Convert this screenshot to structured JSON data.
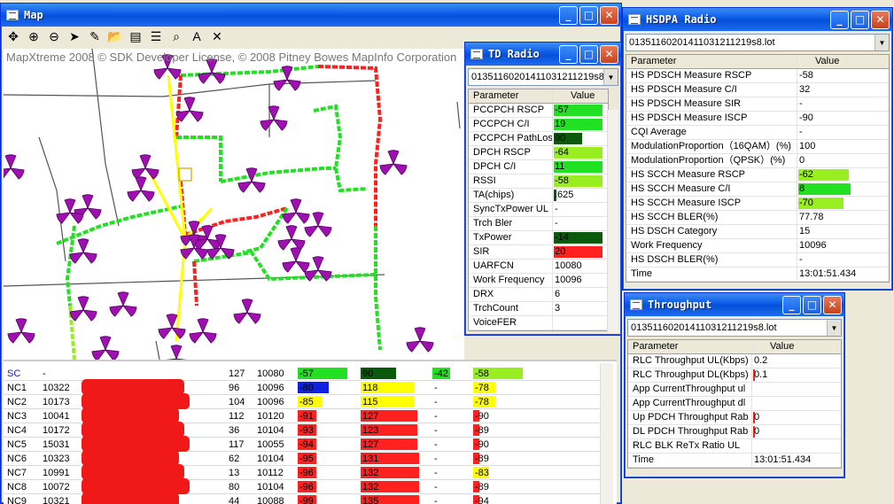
{
  "colors": {
    "green": "#22e022",
    "lightgreen": "#99ee22",
    "darkgreen": "#0b5a0b",
    "yellow": "#ffff00",
    "red": "#ff2020",
    "blue": "#1020e0"
  },
  "map": {
    "title": "Map",
    "copyright": "MapXtreme 2008 © SDK Developer License, © 2008 Pitney Bowes MapInfo Corporation",
    "tools": [
      "pan-icon",
      "zoom-in-icon",
      "zoom-out-icon",
      "pointer-icon",
      "ruler-icon",
      "open-folder-icon",
      "layers-icon",
      "legend-icon",
      "find-icon",
      "text-icon",
      "clear-icon"
    ],
    "tool_glyphs": [
      "✥",
      "⊕",
      "⊖",
      "➤",
      "✎",
      "📂",
      "▤",
      "☰",
      "⌕",
      "A",
      "✕"
    ]
  },
  "td_radio": {
    "title": "TD Radio",
    "file": "01351160201411031211219s8.lot",
    "col_param": "Parameter",
    "col_value": "Value",
    "rows": [
      {
        "p": "PCCPCH RSCP",
        "v": "-57",
        "bar": 0.95,
        "c": "green"
      },
      {
        "p": "PCCPCH C/I",
        "v": "19",
        "bar": 0.95,
        "c": "green"
      },
      {
        "p": "PCCPCH PathLoss",
        "v": "90",
        "bar": 0.55,
        "c": "darkgreen"
      },
      {
        "p": "DPCH RSCP",
        "v": "-64",
        "bar": 0.95,
        "c": "lightgreen"
      },
      {
        "p": "DPCH C/I",
        "v": "11",
        "bar": 0.95,
        "c": "green"
      },
      {
        "p": "RSSI",
        "v": "-58",
        "bar": 0.95,
        "c": "lightgreen"
      },
      {
        "p": "TA(chips)",
        "v": ".625",
        "bar": 0.06,
        "c": "darkgreen"
      },
      {
        "p": "SyncTxPower UL",
        "v": "-",
        "bar": 0,
        "c": ""
      },
      {
        "p": "Trch Bler",
        "v": "-",
        "bar": 0,
        "c": ""
      },
      {
        "p": "TxPower",
        "v": "-14",
        "bar": 0.95,
        "c": "darkgreen"
      },
      {
        "p": "SIR",
        "v": "20",
        "bar": 0.95,
        "c": "red"
      },
      {
        "p": "UARFCN",
        "v": "10080",
        "bar": 0,
        "c": ""
      },
      {
        "p": "Work Frequency",
        "v": "10096",
        "bar": 0,
        "c": ""
      },
      {
        "p": "DRX",
        "v": "6",
        "bar": 0,
        "c": ""
      },
      {
        "p": "TrchCount",
        "v": "3",
        "bar": 0,
        "c": ""
      },
      {
        "p": "VoiceFER",
        "v": "",
        "bar": 0,
        "c": ""
      }
    ]
  },
  "hsdpa": {
    "title": "HSDPA Radio",
    "file": "01351160201411031211219s8.lot",
    "col_param": "Parameter",
    "col_value": "Value",
    "rows": [
      {
        "p": "HS PDSCH Measure RSCP",
        "v": "-58",
        "bar": 0,
        "c": ""
      },
      {
        "p": "HS PDSCH Measure C/I",
        "v": "32",
        "bar": 0,
        "c": ""
      },
      {
        "p": "HS PDSCH Measure SIR",
        "v": "-",
        "bar": 0,
        "c": ""
      },
      {
        "p": "HS PDSCH Measure ISCP",
        "v": "-90",
        "bar": 0,
        "c": ""
      },
      {
        "p": "CQI Average",
        "v": "-",
        "bar": 0,
        "c": ""
      },
      {
        "p": "ModulationProportion（16QAM）(%)",
        "v": "100",
        "bar": 0,
        "c": ""
      },
      {
        "p": "ModulationProportion（QPSK）(%)",
        "v": "0",
        "bar": 0,
        "c": ""
      },
      {
        "p": "HS SCCH Measure RSCP",
        "v": "-62",
        "bar": 0.58,
        "c": "lightgreen"
      },
      {
        "p": "HS SCCH Measure C/I",
        "v": "8",
        "bar": 0.6,
        "c": "green"
      },
      {
        "p": "HS SCCH Measure ISCP",
        "v": "-70",
        "bar": 0.52,
        "c": "lightgreen"
      },
      {
        "p": "HS SCCH BLER(%)",
        "v": "77.78",
        "bar": 0,
        "c": ""
      },
      {
        "p": "HS DSCH Category",
        "v": "15",
        "bar": 0,
        "c": ""
      },
      {
        "p": "Work Frequency",
        "v": "10096",
        "bar": 0,
        "c": ""
      },
      {
        "p": "HS DSCH BLER(%)",
        "v": "-",
        "bar": 0,
        "c": ""
      },
      {
        "p": "Time",
        "v": "13:01:51.434",
        "bar": 0,
        "c": ""
      }
    ]
  },
  "throughput": {
    "title": "Throughput",
    "file": "01351160201411031211219s8.lot",
    "col_param": "Parameter",
    "col_value": "Value",
    "rows": [
      {
        "p": "RLC Throughput UL(Kbps)",
        "v": "0.2",
        "bar": 0,
        "c": ""
      },
      {
        "p": "RLC Throughput DL(Kbps)",
        "v": "0.1",
        "bar": 0.02,
        "c": "red"
      },
      {
        "p": "App CurrentThroughput ul",
        "v": "",
        "bar": 0,
        "c": ""
      },
      {
        "p": "App CurrentThroughput dl",
        "v": "",
        "bar": 0,
        "c": ""
      },
      {
        "p": "Up PDCH Throughput Rab",
        "v": "0",
        "bar": 0.02,
        "c": "red"
      },
      {
        "p": "DL PDCH Throughput Rab",
        "v": "0",
        "bar": 0.02,
        "c": "red"
      },
      {
        "p": "RLC BLK ReTx Ratio UL",
        "v": "",
        "bar": 0,
        "c": ""
      },
      {
        "p": "Time",
        "v": "13:01:51.434",
        "bar": 0,
        "c": ""
      }
    ]
  },
  "nc_table": {
    "rows": [
      {
        "name": "SC",
        "sc_color": true,
        "freq": "-",
        "cid": "127",
        "uarfcn": "10080",
        "rscp": "-57",
        "rscp_bar": 0.8,
        "rscp_c": "green",
        "pl": "90",
        "pl_bar": 0.5,
        "pl_c": "darkgreen",
        "d": "-42",
        "d_bar": 0.45,
        "d_c": "green",
        "e": "-58",
        "e_bar": 0.8,
        "e_c": "lightgreen"
      },
      {
        "name": "NC1",
        "freq": "10322",
        "cid": "96",
        "uarfcn": "10096",
        "rscp": "-80",
        "rscp_bar": 0.5,
        "rscp_c": "blue",
        "pl": "118",
        "pl_bar": 0.75,
        "pl_c": "yellow",
        "d": "-",
        "d_bar": 0,
        "d_c": "",
        "e": "-78",
        "e_bar": 0.35,
        "e_c": "yellow"
      },
      {
        "name": "NC2",
        "freq": "10173",
        "cid": "104",
        "uarfcn": "10096",
        "rscp": "-85",
        "rscp_bar": 0.4,
        "rscp_c": "yellow",
        "pl": "115",
        "pl_bar": 0.75,
        "pl_c": "yellow",
        "d": "-",
        "d_bar": 0,
        "d_c": "",
        "e": "-78",
        "e_bar": 0.35,
        "e_c": "yellow"
      },
      {
        "name": "NC3",
        "freq": "10041",
        "cid": "112",
        "uarfcn": "10120",
        "rscp": "-91",
        "rscp_bar": 0.3,
        "rscp_c": "red",
        "pl": "127",
        "pl_bar": 0.8,
        "pl_c": "red",
        "d": "-",
        "d_bar": 0,
        "d_c": "",
        "e": "-90",
        "e_bar": 0.1,
        "e_c": "red"
      },
      {
        "name": "NC4",
        "freq": "10172",
        "cid": "36",
        "uarfcn": "10104",
        "rscp": "-93",
        "rscp_bar": 0.3,
        "rscp_c": "red",
        "pl": "123",
        "pl_bar": 0.8,
        "pl_c": "red",
        "d": "-",
        "d_bar": 0,
        "d_c": "",
        "e": "-89",
        "e_bar": 0.1,
        "e_c": "red"
      },
      {
        "name": "NC5",
        "freq": "15031",
        "cid": "117",
        "uarfcn": "10055",
        "rscp": "-94",
        "rscp_bar": 0.3,
        "rscp_c": "red",
        "pl": "127",
        "pl_bar": 0.8,
        "pl_c": "red",
        "d": "-",
        "d_bar": 0,
        "d_c": "",
        "e": "-90",
        "e_bar": 0.1,
        "e_c": "red"
      },
      {
        "name": "NC6",
        "freq": "10323",
        "cid": "62",
        "uarfcn": "10104",
        "rscp": "-95",
        "rscp_bar": 0.3,
        "rscp_c": "red",
        "pl": "131",
        "pl_bar": 0.82,
        "pl_c": "red",
        "d": "-",
        "d_bar": 0,
        "d_c": "",
        "e": "-89",
        "e_bar": 0.1,
        "e_c": "red"
      },
      {
        "name": "NC7",
        "freq": "10991",
        "cid": "13",
        "uarfcn": "10112",
        "rscp": "-96",
        "rscp_bar": 0.3,
        "rscp_c": "red",
        "pl": "132",
        "pl_bar": 0.82,
        "pl_c": "red",
        "d": "-",
        "d_bar": 0,
        "d_c": "",
        "e": "-83",
        "e_bar": 0.25,
        "e_c": "yellow"
      },
      {
        "name": "NC8",
        "freq": "10072",
        "cid": "80",
        "uarfcn": "10104",
        "rscp": "-96",
        "rscp_bar": 0.3,
        "rscp_c": "red",
        "pl": "132",
        "pl_bar": 0.82,
        "pl_c": "red",
        "d": "-",
        "d_bar": 0,
        "d_c": "",
        "e": "-89",
        "e_bar": 0.1,
        "e_c": "red"
      },
      {
        "name": "NC9",
        "freq": "10321",
        "cid": "44",
        "uarfcn": "10088",
        "rscp": "-99",
        "rscp_bar": 0.3,
        "rscp_c": "red",
        "pl": "135",
        "pl_bar": 0.82,
        "pl_c": "red",
        "d": "-",
        "d_bar": 0,
        "d_c": "",
        "e": "-94",
        "e_bar": 0.1,
        "e_c": "red"
      }
    ]
  }
}
